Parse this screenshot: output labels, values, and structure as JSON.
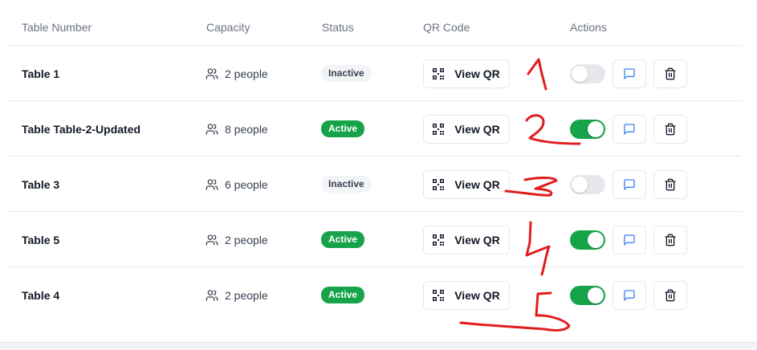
{
  "columns": {
    "table_number": "Table Number",
    "capacity": "Capacity",
    "status": "Status",
    "qr_code": "QR Code",
    "actions": "Actions"
  },
  "rows": [
    {
      "name": "Table 1",
      "capacity": "2 people",
      "status": "Inactive",
      "qr_label": "View QR",
      "active": false
    },
    {
      "name": "Table Table-2-Updated",
      "capacity": "8 people",
      "status": "Active",
      "qr_label": "View QR",
      "active": true
    },
    {
      "name": "Table 3",
      "capacity": "6 people",
      "status": "Inactive",
      "qr_label": "View QR",
      "active": false
    },
    {
      "name": "Table 5",
      "capacity": "2 people",
      "status": "Active",
      "qr_label": "View QR",
      "active": true
    },
    {
      "name": "Table 4",
      "capacity": "2 people",
      "status": "Active",
      "qr_label": "View QR",
      "active": true
    }
  ],
  "colors": {
    "active_green": "#16a34a",
    "message_blue": "#3b82f6",
    "annotation_red": "#e11d1d"
  },
  "icons": {
    "capacity": "users-icon",
    "qr": "qr-code-icon",
    "message": "message-square-icon",
    "delete": "trash-icon"
  }
}
